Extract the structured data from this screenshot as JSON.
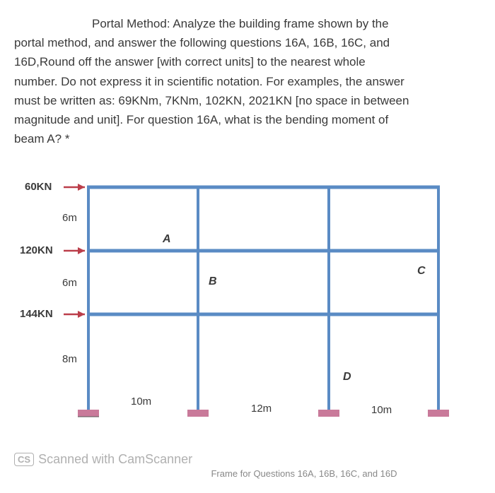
{
  "question": {
    "text_line1": "Portal Method: Analyze the building frame shown by the",
    "text_line2": "portal method, and answer the following questions 16A, 16B, 16C, and",
    "text_line3": "16D,Round off the answer [with correct units] to the nearest whole",
    "text_line4": "number. Do not express it in scientific notation. For examples, the answer",
    "text_line5": "must be written as: 69KNm, 7KNm, 102KN, 2021KN [no space in between",
    "text_line6": "magnitude and unit]. For question 16A, what is the bending moment of",
    "text_line7": "beam A? *"
  },
  "loads": {
    "top": "60KN",
    "mid": "120KN",
    "bot": "144KN"
  },
  "heights": {
    "top": "6m",
    "mid": "6m",
    "bot": "8m"
  },
  "spans": {
    "left": "10m",
    "mid": "12m",
    "right": "10m"
  },
  "labels": {
    "A": "A",
    "B": "B",
    "C": "C",
    "D": "D"
  },
  "footer": {
    "badge": "CS",
    "text": "Scanned with CamScanner",
    "caption": "Frame for Questions 16A, 16B, 16C, and 16D"
  },
  "chart_data": {
    "type": "diagram",
    "description": "Building frame for portal method analysis",
    "lateral_loads_KN": [
      60,
      120,
      144
    ],
    "load_levels_from_top": [
      "roof",
      "2nd floor",
      "1st floor"
    ],
    "storey_heights_m": [
      6,
      6,
      8
    ],
    "bay_widths_m": [
      10,
      12,
      10
    ],
    "columns": 4,
    "storeys": 3,
    "member_labels": {
      "A": "beam, 2nd level, bay 1",
      "B": "column, 2nd storey, line 2",
      "C": "column, 2nd storey, line 4 (exterior right)",
      "D": "column, 1st storey, line 3"
    }
  }
}
